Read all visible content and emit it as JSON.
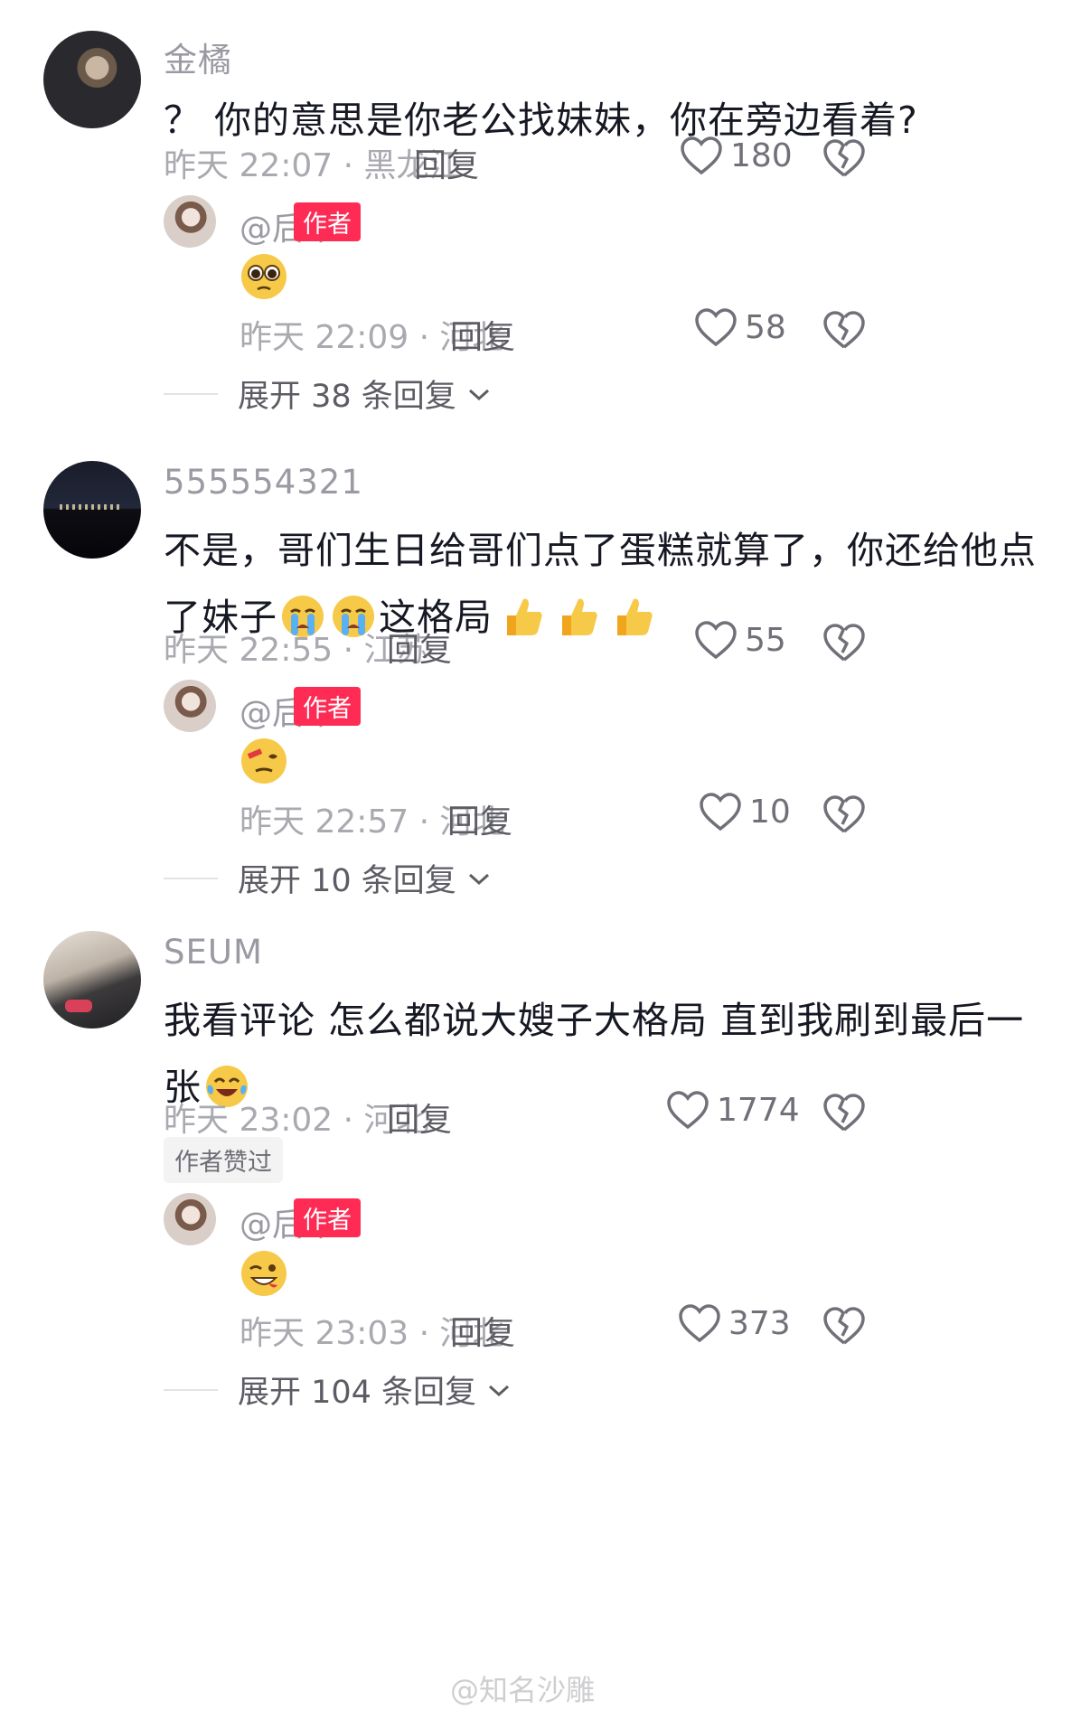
{
  "comments": [
    {
      "username": "金橘",
      "text": "？ 你的意思是你老公找妹妹，你在旁边看着?",
      "meta": "昨天 22:07 · 黑龙江",
      "reply_label": "回复",
      "likes": "180",
      "reply": {
        "username": "@后来",
        "author_tag": "作者",
        "emoji": "pleading-face",
        "meta": "昨天 22:09 · 河北",
        "reply_label": "回复",
        "likes": "58"
      },
      "expand_label": "展开 38 条回复"
    },
    {
      "username": "555554321",
      "text_parts": [
        "不是，哥们生日给哥们点了蛋糕就算了，你还给他点了妹子",
        "这格局"
      ],
      "text_emojis_1": [
        "crying-face",
        "crying-face"
      ],
      "text_emojis_2": [
        "thumbs-up",
        "thumbs-up",
        "thumbs-up"
      ],
      "meta": "昨天 22:55 · 江苏",
      "reply_label": "回复",
      "likes": "55",
      "reply": {
        "username": "@后来",
        "author_tag": "作者",
        "emoji": "dizzy-face",
        "meta": "昨天 22:57 · 河北",
        "reply_label": "回复",
        "likes": "10"
      },
      "expand_label": "展开 10 条回复"
    },
    {
      "username": "SEUM",
      "text": "我看评论 怎么都说大嫂子大格局 直到我刷到最后一张",
      "text_emoji": "tears-of-joy",
      "meta": "昨天 23:02 · 河北",
      "reply_label": "回复",
      "likes": "1774",
      "author_liked": "作者赞过",
      "reply": {
        "username": "@后来",
        "author_tag": "作者",
        "emoji": "winking-face",
        "meta": "昨天 23:03 · 河北",
        "reply_label": "回复",
        "likes": "373"
      },
      "expand_label": "展开 104 条回复"
    }
  ],
  "watermark": "@知名沙雕",
  "colors": {
    "author_tag": "#fe2c55",
    "meta_gray": "#a9a9b0",
    "text": "#161823"
  }
}
